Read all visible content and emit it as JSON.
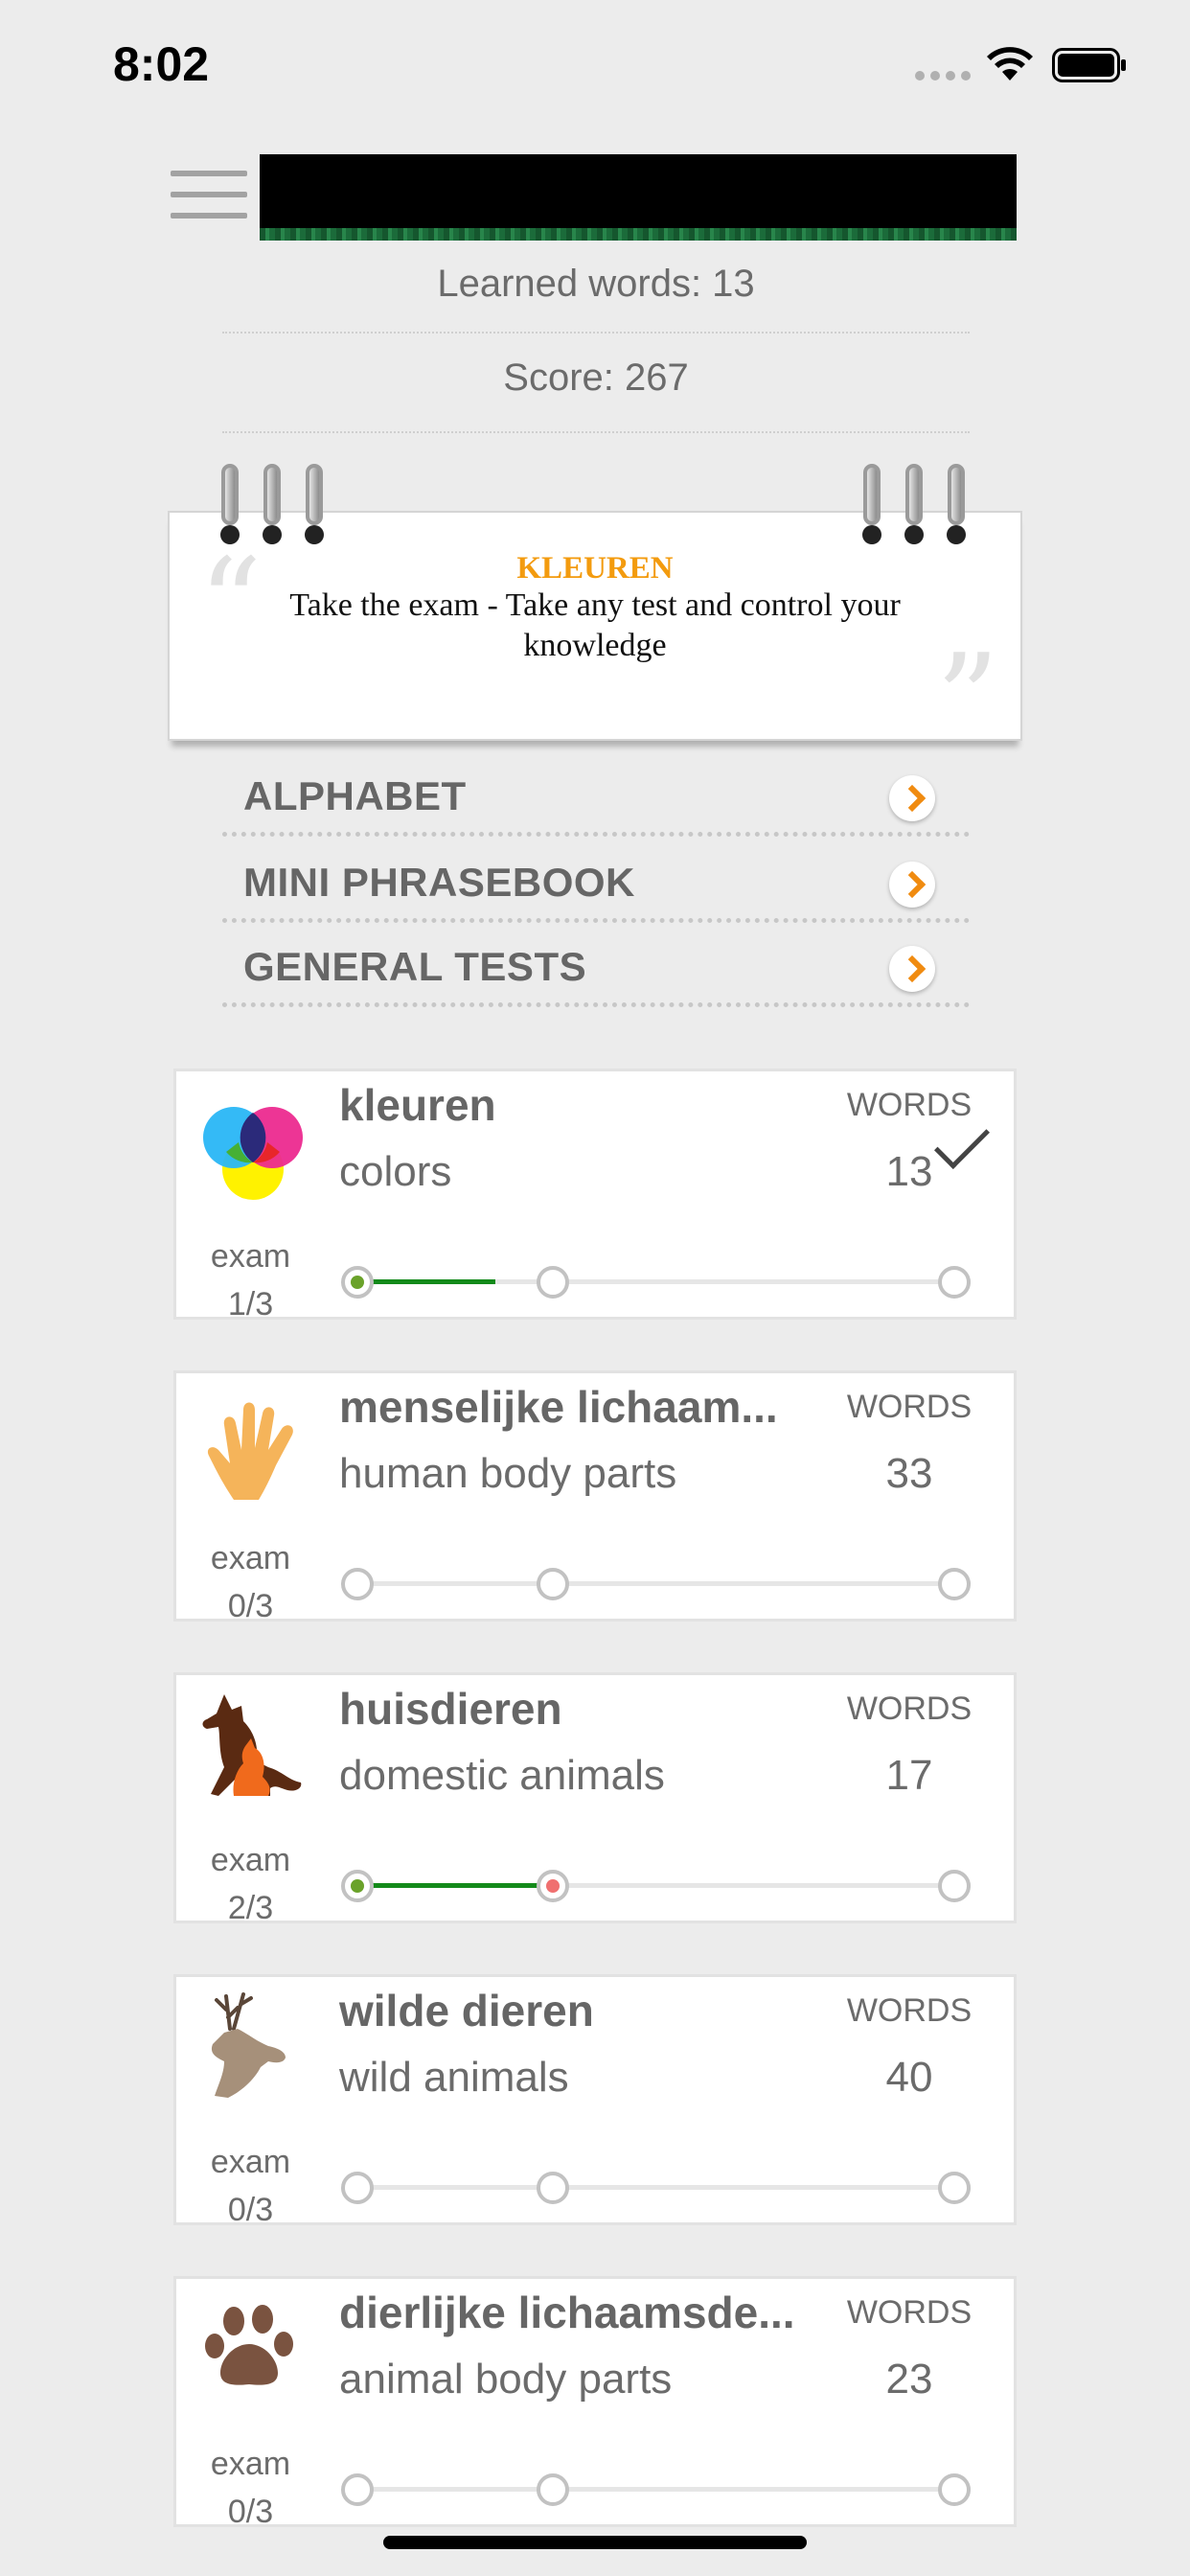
{
  "status": {
    "time": "8:02"
  },
  "stats": {
    "learned": "Learned words: 13",
    "score": "Score: 267"
  },
  "note": {
    "title": "KLEUREN",
    "text": "Take the exam - Take any test and control your knowledge"
  },
  "sections": [
    {
      "label": "ALPHABET"
    },
    {
      "label": "MINI PHRASEBOOK"
    },
    {
      "label": "GENERAL TESTS"
    }
  ],
  "words_label": "WORDS",
  "exam_label": "exam",
  "categories": [
    {
      "title": "kleuren",
      "subtitle": "colors",
      "count": "13",
      "exam": "1/3",
      "icon": "color-circles-icon",
      "completed": true
    },
    {
      "title": "menselijke lichaam...",
      "subtitle": "human body parts",
      "count": "33",
      "exam": "0/3",
      "icon": "hand-icon"
    },
    {
      "title": "huisdieren",
      "subtitle": "domestic animals",
      "count": "17",
      "exam": "2/3",
      "icon": "dog-cat-icon"
    },
    {
      "title": "wilde dieren",
      "subtitle": "wild animals",
      "count": "40",
      "exam": "0/3",
      "icon": "deer-icon"
    },
    {
      "title": "dierlijke lichaamsde...",
      "subtitle": "animal body parts",
      "count": "23",
      "exam": "0/3",
      "icon": "paw-icon"
    }
  ],
  "colors": {
    "accent": "#f39b0e",
    "progress": "#138a1a",
    "banner": "#000000"
  }
}
